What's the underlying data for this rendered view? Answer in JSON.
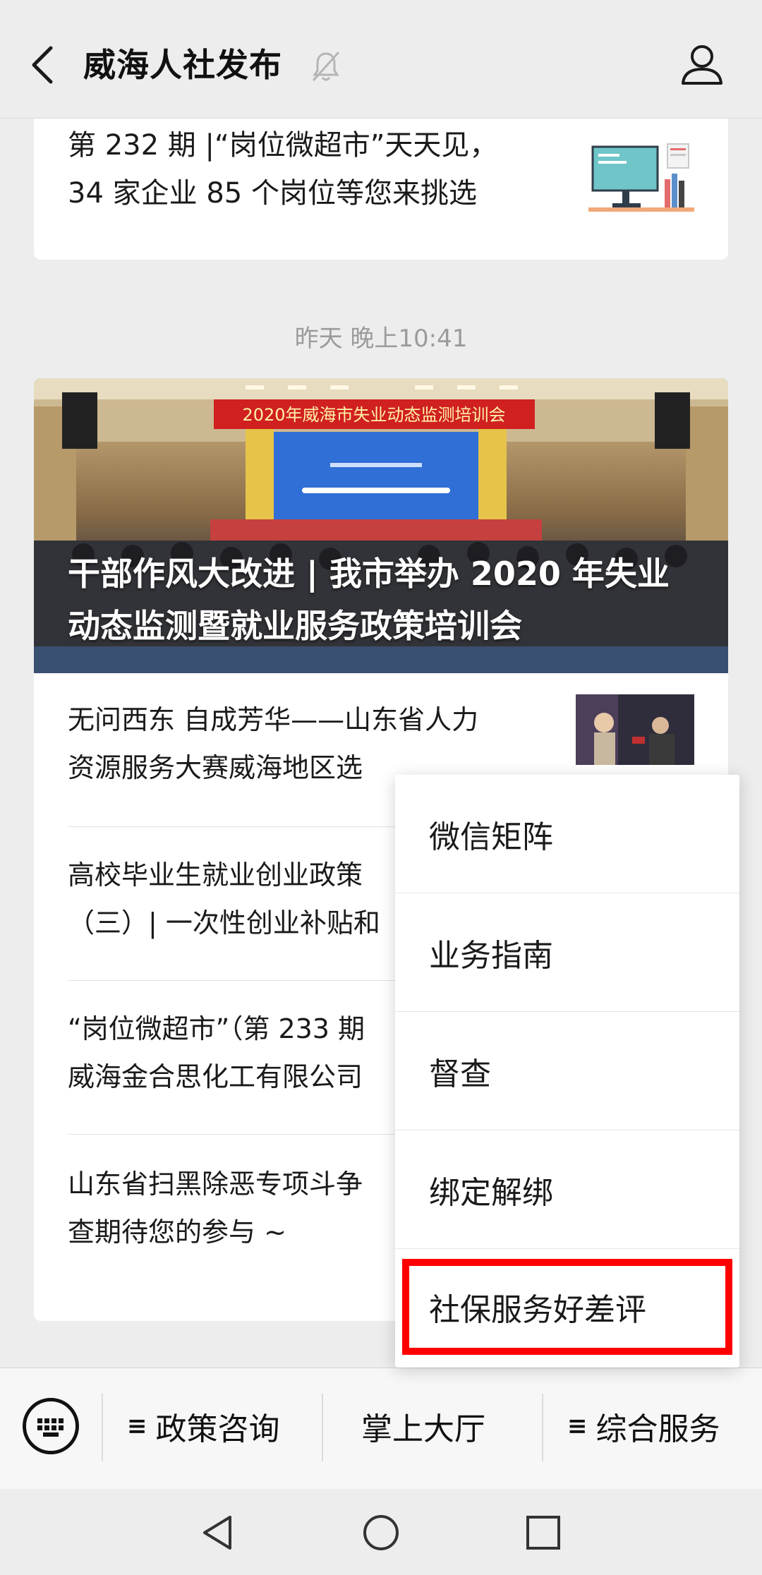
{
  "header": {
    "title": "威海人社发布"
  },
  "articles_top": {
    "line1": "第 232 期 |“岗位微超市”天天见，",
    "line2": "34 家企业 85 个岗位等您来挑选"
  },
  "timestamp": "昨天 晚上10:41",
  "hero": {
    "banner_text": "2020年威海市失业动态监测培训会",
    "title_line1": "干部作风大改进 | 我市举办 2020 年失业",
    "title_line2": "动态监测暨就业服务政策培训会"
  },
  "list": [
    {
      "line1": "无问西东 自成芳华——山东省人力",
      "line2": "资源服务大赛威海地区选"
    },
    {
      "line1": "高校毕业生就业创业政策",
      "line2": "（三）| 一次性创业补贴和"
    },
    {
      "line1": "“岗位微超市”（第 233 期",
      "line2": "威海金合思化工有限公司"
    },
    {
      "line1": "山东省扫黑除恶专项斗争",
      "line2": "查期待您的参与 ~"
    }
  ],
  "menu": {
    "items": [
      "微信矩阵",
      "业务指南",
      "督查",
      "绑定解绑",
      "社保服务好差评"
    ],
    "highlight_color": "#ff0000"
  },
  "bottom_menu": {
    "tabs": [
      "政策咨询",
      "掌上大厅",
      "综合服务"
    ],
    "hamburger": "≡"
  }
}
